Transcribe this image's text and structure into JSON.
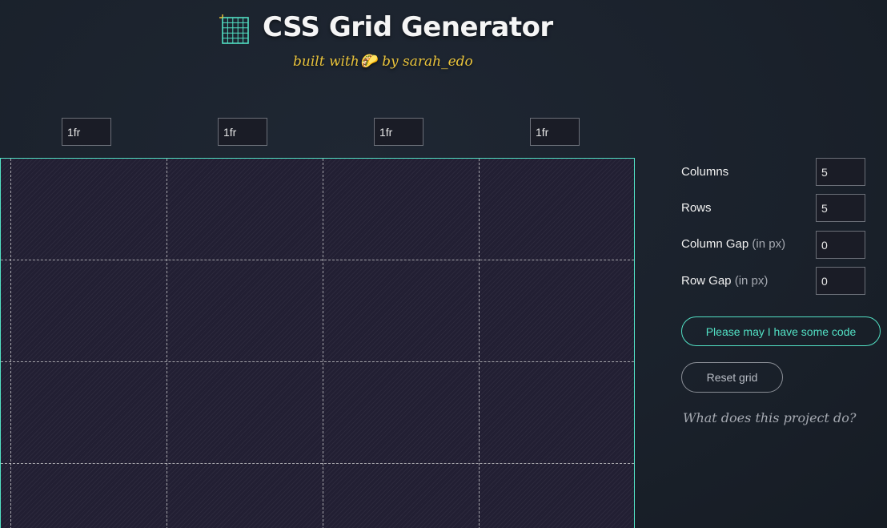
{
  "header": {
    "title": "CSS Grid Generator",
    "subtitle_prefix": "built with",
    "subtitle_emoji": "🌮",
    "subtitle_suffix": "by sarah_edo",
    "logo_icon": "grid-logo-icon"
  },
  "column_inputs": [
    "1fr",
    "1fr",
    "1fr",
    "1fr"
  ],
  "grid": {
    "columns": 5,
    "rows": 5,
    "border_color": "#52e0c4",
    "cell_color": "#221f33"
  },
  "controls": {
    "columns_label": "Columns",
    "columns_value": "5",
    "rows_label": "Rows",
    "rows_value": "5",
    "column_gap_label": "Column Gap",
    "column_gap_unit": "(in px)",
    "column_gap_value": "0",
    "row_gap_label": "Row Gap",
    "row_gap_unit": "(in px)",
    "row_gap_value": "0"
  },
  "buttons": {
    "code_label": "Please may I have some code",
    "reset_label": "Reset grid"
  },
  "links": {
    "about_label": "What does this project do?"
  },
  "colors": {
    "accent": "#52e0c4",
    "subtitle": "#e9c33a",
    "background": "#1a212b"
  }
}
